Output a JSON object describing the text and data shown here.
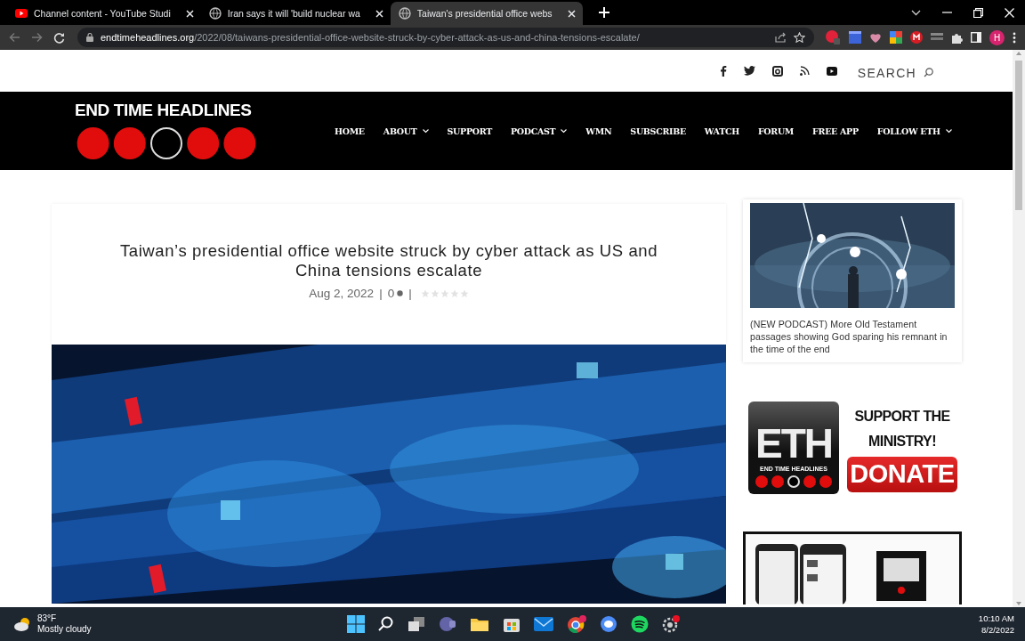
{
  "browser": {
    "tabs": [
      {
        "title": "Channel content - YouTube Studi",
        "kind": "youtube",
        "selected": false
      },
      {
        "title": "Iran says it will 'build nuclear wa",
        "kind": "globe",
        "selected": false
      },
      {
        "title": "Taiwan's presidential office webs",
        "kind": "globe",
        "selected": true
      }
    ],
    "url": {
      "domain": "endtimeheadlines.org",
      "path": "/2022/08/taiwans-presidential-office-website-struck-by-cyber-attack-as-us-and-china-tensions-escalate/"
    },
    "profile_initial": "H"
  },
  "site": {
    "social": [
      {
        "kind": "facebook"
      },
      {
        "kind": "twitter"
      },
      {
        "kind": "instagram"
      },
      {
        "kind": "rss"
      },
      {
        "kind": "youtube"
      }
    ],
    "search_label": "SEARCH",
    "logo_text": "END TIME HEADLINES",
    "nav": [
      {
        "label": "HOME",
        "has_menu": false
      },
      {
        "label": "ABOUT",
        "has_menu": true
      },
      {
        "label": "SUPPORT",
        "has_menu": false
      },
      {
        "label": "PODCAST",
        "has_menu": true
      },
      {
        "label": "WMN",
        "has_menu": false
      },
      {
        "label": "SUBSCRIBE",
        "has_menu": false
      },
      {
        "label": "WATCH",
        "has_menu": false
      },
      {
        "label": "FORUM",
        "has_menu": false
      },
      {
        "label": "FREE APP",
        "has_menu": false
      },
      {
        "label": "FOLLOW ETH",
        "has_menu": true
      }
    ]
  },
  "article": {
    "title": "Taiwan’s presidential office website struck by cyber attack as US and China tensions escalate",
    "meta": [
      {
        "kind": "date",
        "text": "Aug 2, 2022"
      },
      {
        "kind": "separator",
        "text": "|"
      },
      {
        "kind": "comments",
        "text": "0"
      },
      {
        "kind": "separator",
        "text": "|"
      },
      {
        "kind": "rating",
        "stars": 0
      }
    ]
  },
  "sidebar": {
    "podcast": {
      "title": "(NEW PODCAST) More Old Testament passages showing God sparing his remnant in the time of the end"
    },
    "donate": {
      "logo": "ETH",
      "logo_subtitle": "END TIME HEADLINES",
      "heading": "SUPPORT THE MINISTRY!",
      "button": "DONATE"
    }
  },
  "taskbar": {
    "temperature": "83°F",
    "weather": "Mostly cloudy",
    "time": "10:10 AM",
    "date": "8/2/2022"
  }
}
